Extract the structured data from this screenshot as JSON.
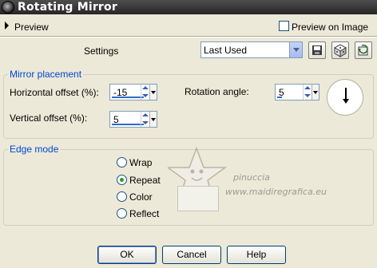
{
  "window": {
    "title": "Rotating Mirror"
  },
  "preview": {
    "label": "Preview",
    "preview_on_image_label": "Preview on Image",
    "preview_on_image_checked": false
  },
  "settings": {
    "label": "Settings",
    "selected": "Last Used"
  },
  "mirror_placement": {
    "legend": "Mirror placement",
    "horizontal_offset_label": "Horizontal offset (%):",
    "horizontal_offset_value": "-15",
    "vertical_offset_label": "Vertical offset (%):",
    "vertical_offset_value": "5",
    "rotation_angle_label": "Rotation angle:",
    "rotation_angle_value": "5"
  },
  "edge_mode": {
    "legend": "Edge mode",
    "options": [
      "Wrap",
      "Repeat",
      "Color",
      "Reflect"
    ],
    "selected": "Repeat"
  },
  "watermark": {
    "name": "pinuccia",
    "site": "www.maidiregrafica.eu"
  },
  "buttons": {
    "ok": "OK",
    "cancel": "Cancel",
    "help": "Help"
  },
  "icons": {
    "save": "save-icon",
    "randomize": "dice-icon",
    "reset": "reset-icon",
    "dial": "rotation-dial-icon",
    "star": "star-watermark-icon"
  }
}
